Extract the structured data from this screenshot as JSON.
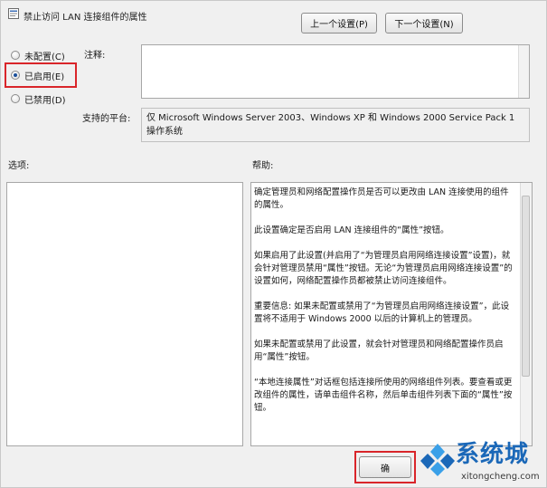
{
  "dialog": {
    "title": "禁止访问 LAN 连接组件的属性"
  },
  "nav": {
    "prev_label": "上一个设置(P)",
    "next_label": "下一个设置(N)"
  },
  "state": {
    "options": [
      {
        "label": "未配置(C)",
        "checked": false
      },
      {
        "label": "已启用(E)",
        "checked": true
      },
      {
        "label": "已禁用(D)",
        "checked": false
      }
    ]
  },
  "comment": {
    "label": "注释:",
    "value": ""
  },
  "platform": {
    "label": "支持的平台:",
    "value": "仅 Microsoft Windows Server 2003、Windows XP 和 Windows 2000 Service Pack 1 操作系统"
  },
  "options_panel": {
    "label": "选项:"
  },
  "help": {
    "label": "帮助:",
    "paragraphs": [
      "确定管理员和网络配置操作员是否可以更改由 LAN 连接使用的组件的属性。",
      "此设置确定是否启用 LAN 连接组件的“属性”按钮。",
      "如果启用了此设置(并启用了“为管理员启用网络连接设置”设置)，就会针对管理员禁用“属性”按钮。无论“为管理员启用网络连接设置”的设置如何，网络配置操作员都被禁止访问连接组件。",
      "重要信息: 如果未配置或禁用了“为管理员启用网络连接设置”，此设置将不适用于 Windows 2000 以后的计算机上的管理员。",
      "如果未配置或禁用了此设置，就会针对管理员和网络配置操作员启用“属性”按钮。",
      "“本地连接属性”对话框包括连接所使用的网络组件列表。要查看或更改组件的属性，请单击组件名称，然后单击组件列表下面的“属性”按钮。"
    ]
  },
  "footer": {
    "ok_label": "确"
  },
  "watermark": {
    "brand": "系统城",
    "url": "xitongcheng.com"
  },
  "colors": {
    "highlight": "#d9252a",
    "brand": "#1b68b8"
  }
}
